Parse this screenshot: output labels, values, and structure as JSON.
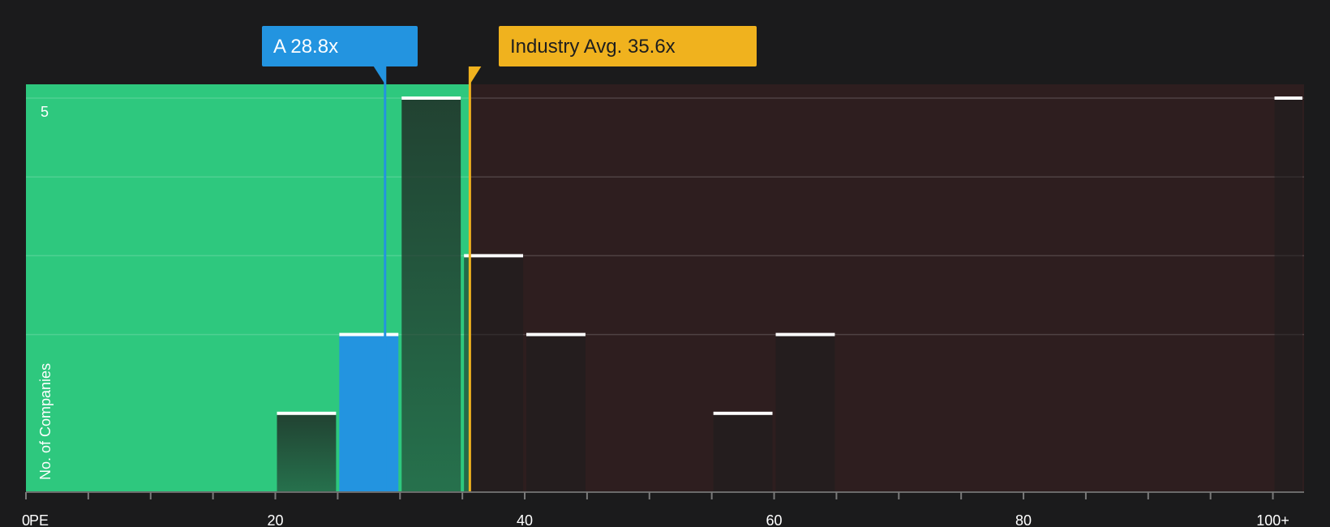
{
  "chart_data": {
    "type": "bar",
    "xlabel": "PE",
    "ylabel": "No. of Companies",
    "x_tick_labels": [
      "0",
      "20",
      "40",
      "60",
      "80",
      "100+"
    ],
    "x_tick_values": [
      0,
      20,
      40,
      60,
      80,
      100
    ],
    "xlim": [
      0,
      102.5
    ],
    "ylim": [
      0,
      5
    ],
    "y_tick_labels": [
      "5"
    ],
    "grid": true,
    "bin_width": 5,
    "bars": [
      {
        "x0": 20,
        "x1": 25,
        "value": 1
      },
      {
        "x0": 25,
        "x1": 30,
        "value": 2,
        "highlight": true
      },
      {
        "x0": 30,
        "x1": 35,
        "value": 5
      },
      {
        "x0": 35,
        "x1": 40,
        "value": 3
      },
      {
        "x0": 40,
        "x1": 45,
        "value": 2
      },
      {
        "x0": 55,
        "x1": 60,
        "value": 1
      },
      {
        "x0": 60,
        "x1": 65,
        "value": 2
      },
      {
        "x0": 100,
        "x1": 102.5,
        "value": 5
      }
    ],
    "markers": [
      {
        "name": "A",
        "label": "A 28.8x",
        "value": 28.8,
        "color": "#2394e0"
      },
      {
        "name": "Industry Avg.",
        "label": "Industry Avg. 35.6x",
        "value": 35.6,
        "color": "#f0b21e"
      }
    ],
    "regions": [
      {
        "from": 0,
        "to": 35.6,
        "color": "#2ec87e"
      },
      {
        "from": 35.6,
        "to": 102.5,
        "color": "#2e1e1f"
      }
    ],
    "colors": {
      "background": "#1b1b1c",
      "undervalued": "#2ec87e",
      "overvalued": "#2e1e1f",
      "highlight_bar": "#2394e0",
      "bar_cap": "#ffffff"
    }
  }
}
